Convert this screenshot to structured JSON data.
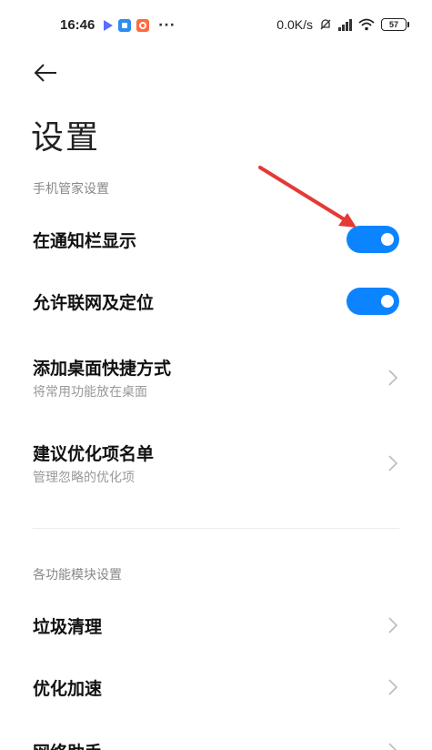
{
  "status_bar": {
    "time": "16:46",
    "more": "···",
    "net_speed": "0.0K/s",
    "battery": "57"
  },
  "header": {
    "title": "设置"
  },
  "sections": [
    {
      "label": "手机管家设置",
      "items": [
        {
          "title": "在通知栏显示",
          "type": "toggle",
          "on": true
        },
        {
          "title": "允许联网及定位",
          "type": "toggle",
          "on": true
        },
        {
          "title": "添加桌面快捷方式",
          "subtitle": "将常用功能放在桌面",
          "type": "link"
        },
        {
          "title": "建议优化项名单",
          "subtitle": "管理忽略的优化项",
          "type": "link"
        }
      ]
    },
    {
      "label": "各功能模块设置",
      "items": [
        {
          "title": "垃圾清理",
          "type": "link"
        },
        {
          "title": "优化加速",
          "type": "link"
        },
        {
          "title": "网络助手",
          "type": "link"
        }
      ]
    }
  ],
  "colors": {
    "accent": "#0d84ff",
    "annotation": "#e53935"
  },
  "icons": [
    "back-arrow-icon",
    "chevron-right-icon",
    "wifi-icon",
    "signal-icon",
    "mute-icon",
    "battery-icon"
  ]
}
